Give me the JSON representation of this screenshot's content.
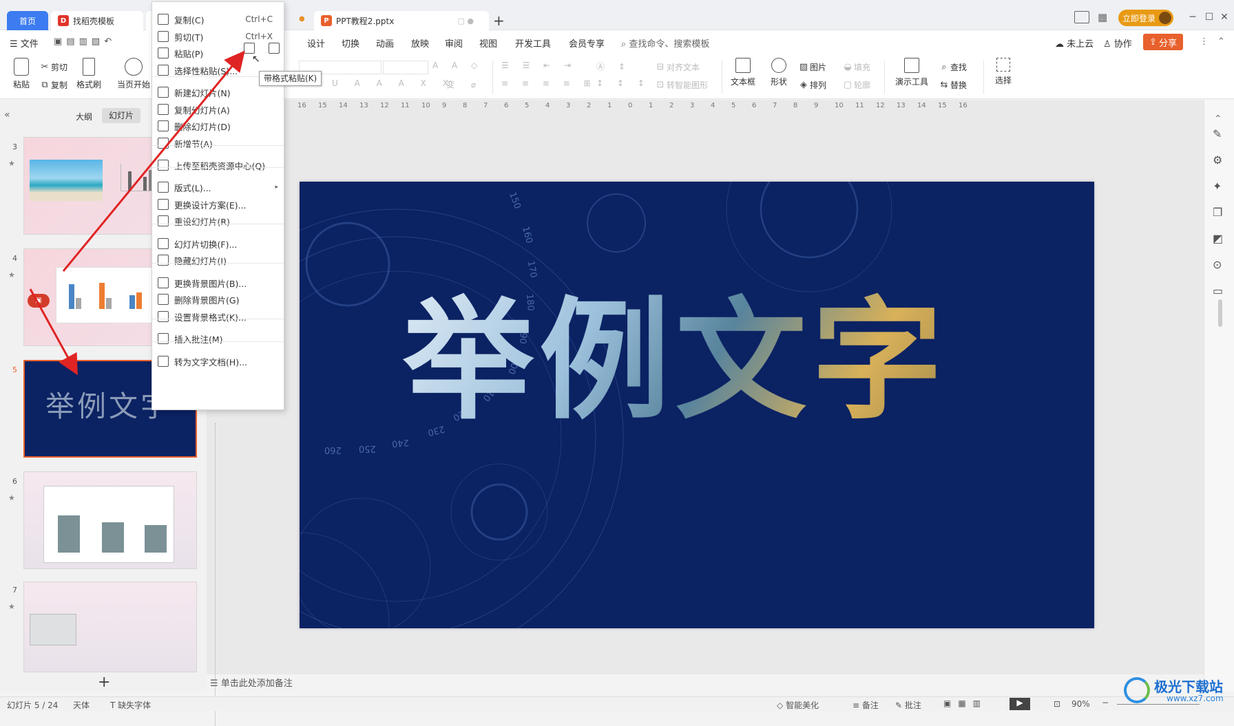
{
  "titlebar": {
    "tabs": [
      {
        "label": "首页"
      },
      {
        "label": "找稻壳模板"
      },
      {
        "label": "PPT教程2.pptx"
      }
    ],
    "new_tab": "+",
    "login_button": "立即登录"
  },
  "menubar": {
    "file": "文件",
    "items": [
      "设计",
      "切换",
      "动画",
      "放映",
      "审阅",
      "视图",
      "开发工具",
      "会员专享"
    ],
    "search_placeholder": "查找命令、搜索模板",
    "cloud": "未上云",
    "collab": "协作",
    "share": "分享"
  },
  "ribbon": {
    "paste": "粘贴",
    "cut": "剪切",
    "copy": "复制",
    "format_painter": "格式刷",
    "play_from_current": "当页开始",
    "align_text": "对齐文本",
    "smart_shape": "转智能图形",
    "textbox": "文本框",
    "shape": "形状",
    "picture": "图片",
    "arrange": "排列",
    "fill": "填充",
    "outline": "轮廓",
    "presentation_tools": "演示工具",
    "find": "查找",
    "replace": "替换",
    "select": "选择"
  },
  "leftpanel": {
    "tab_outline": "大纲",
    "tab_slides": "幻灯片",
    "slides": [
      {
        "num": "3"
      },
      {
        "num": "4"
      },
      {
        "num": "5",
        "title": "举例文字"
      },
      {
        "num": "6"
      },
      {
        "num": "7"
      }
    ],
    "add": "+"
  },
  "context_menu": {
    "items": [
      {
        "label": "复制(C)",
        "shortcut": "Ctrl+C"
      },
      {
        "label": "剪切(T)",
        "shortcut": "Ctrl+X"
      },
      {
        "label": "粘贴(P)"
      },
      {
        "label": "选择性粘贴(S)..."
      },
      {
        "label": "新建幻灯片(N)"
      },
      {
        "label": "复制幻灯片(A)"
      },
      {
        "label": "删除幻灯片(D)"
      },
      {
        "label": "新增节(A)"
      },
      {
        "label": "上传至稻壳资源中心(Q)"
      },
      {
        "label": "版式(L)..."
      },
      {
        "label": "更换设计方案(E)..."
      },
      {
        "label": "重设幻灯片(R)"
      },
      {
        "label": "幻灯片切换(F)..."
      },
      {
        "label": "隐藏幻灯片(I)"
      },
      {
        "label": "更换背景图片(B)..."
      },
      {
        "label": "删除背景图片(G)"
      },
      {
        "label": "设置背景格式(K)..."
      },
      {
        "label": "插入批注(M)"
      },
      {
        "label": "转为文字文档(H)..."
      }
    ],
    "tooltip": "带格式粘贴(K)"
  },
  "slide": {
    "title": "举例文字",
    "dial_labels": [
      "150",
      "160",
      "170",
      "180",
      "190",
      "200",
      "210",
      "220",
      "230",
      "240",
      "250",
      "260"
    ]
  },
  "ruler": {
    "labels": [
      "16",
      "15",
      "14",
      "13",
      "12",
      "11",
      "10",
      "9",
      "8",
      "7",
      "6",
      "5",
      "4",
      "3",
      "2",
      "1",
      "0",
      "1",
      "2",
      "3",
      "4",
      "5",
      "6",
      "7",
      "8",
      "9",
      "10",
      "11",
      "12",
      "13",
      "14",
      "15",
      "16"
    ]
  },
  "notes": {
    "placeholder": "单击此处添加备注"
  },
  "statusbar": {
    "slide_count": "幻灯片 5 / 24",
    "theme": "天体",
    "missing_font": "缺失字体",
    "smart_beautify": "智能美化",
    "notes": "备注",
    "comments": "批注",
    "zoom": "90%"
  },
  "watermark": {
    "text": "极光下载站",
    "url": "www.xz7.com"
  },
  "colors": {
    "accent": "#e8602c",
    "slide_bg": "#0b2263",
    "selected": "#e8602c"
  }
}
